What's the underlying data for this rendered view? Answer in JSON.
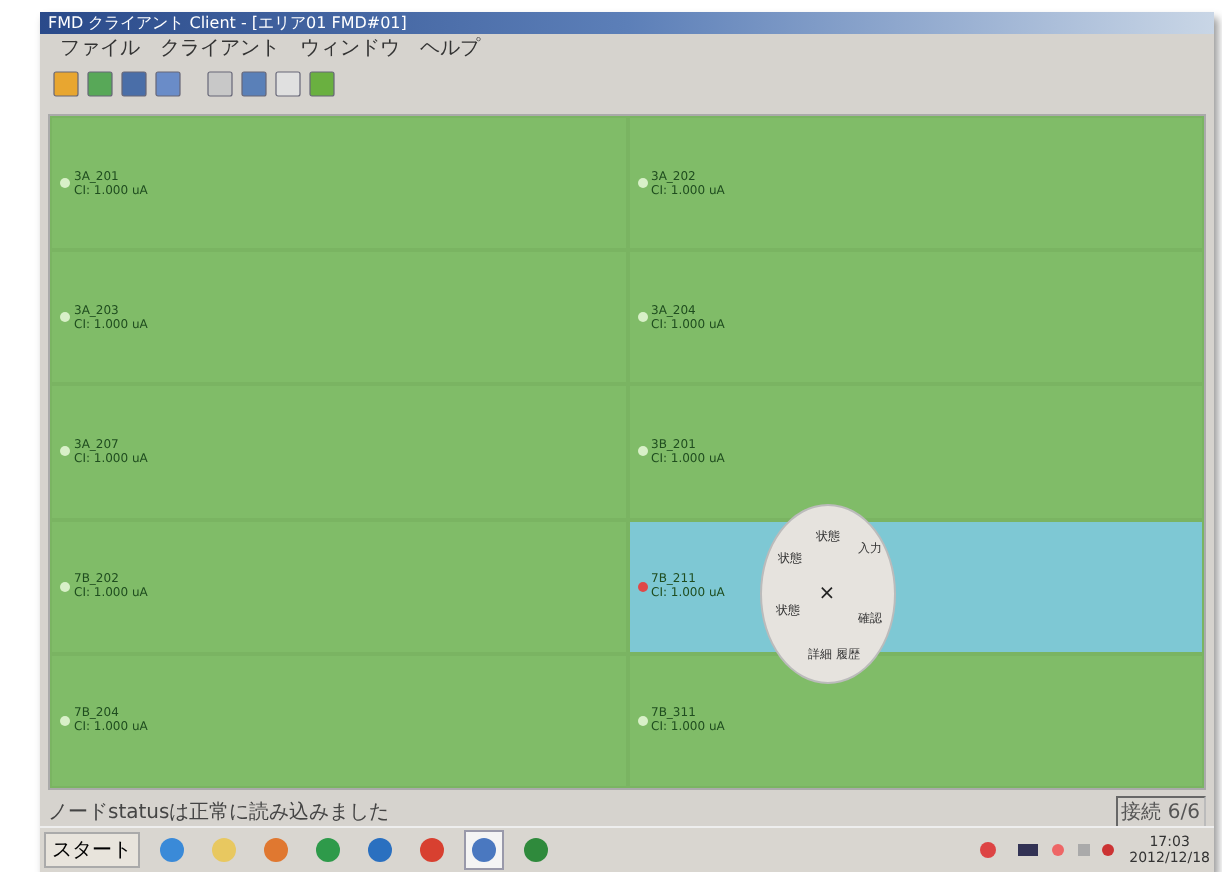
{
  "window": {
    "title": "FMD クライアント Client - [エリア01 FMD#01]"
  },
  "menu": [
    {
      "label": "ファイル"
    },
    {
      "label": "クライアント"
    },
    {
      "label": "ウィンドウ"
    },
    {
      "label": "ヘルプ"
    }
  ],
  "toolbar": [
    {
      "kind": "new"
    },
    {
      "kind": "open"
    },
    {
      "kind": "save"
    },
    {
      "kind": "grid"
    },
    {
      "kind": "sep"
    },
    {
      "kind": "page"
    },
    {
      "kind": "doc"
    },
    {
      "kind": "shield"
    },
    {
      "kind": "battery"
    }
  ],
  "tiles": [
    {
      "name": "3A_201",
      "reading": "CI:  1.000 uA",
      "color": "#d8f0c8",
      "selected": false
    },
    {
      "name": "3A_202",
      "reading": "CI:  1.000 uA",
      "color": "#d8f0c8",
      "selected": false
    },
    {
      "name": "3A_203",
      "reading": "CI:  1.000 uA",
      "color": "#d8f0c8",
      "selected": false
    },
    {
      "name": "3A_204",
      "reading": "CI:  1.000 uA",
      "color": "#d8f0c8",
      "selected": false
    },
    {
      "name": "3A_207",
      "reading": "CI:  1.000 uA",
      "color": "#d8f0c8",
      "selected": false
    },
    {
      "name": "3B_201",
      "reading": "CI:  1.000 uA",
      "color": "#d8f0c8",
      "selected": false
    },
    {
      "name": "7B_202",
      "reading": "CI:  1.000 uA",
      "color": "#d8f0c8",
      "selected": false
    },
    {
      "name": "7B_211",
      "reading": "CI:  1.000 uA",
      "color": "#e04848",
      "selected": true
    },
    {
      "name": "7B_204",
      "reading": "CI:  1.000 uA",
      "color": "#d8f0c8",
      "selected": false
    },
    {
      "name": "7B_311",
      "reading": "CI:  1.000 uA",
      "color": "#d8f0c8",
      "selected": false
    }
  ],
  "pie_menu": {
    "close": "×",
    "items": [
      "状態",
      "入力",
      "確認",
      "詳細 履歴",
      "状態",
      "状態"
    ]
  },
  "status_bar": {
    "message": "ノードstatusは正常に読み込みました",
    "info": "接続 6/6"
  },
  "taskbar": {
    "start": "スタート",
    "apps": [
      {
        "kind": "ie"
      },
      {
        "kind": "folder"
      },
      {
        "kind": "media"
      },
      {
        "kind": "green"
      },
      {
        "kind": "globe"
      },
      {
        "kind": "chrome"
      },
      {
        "kind": "network",
        "selected": true
      },
      {
        "kind": "excel",
        "selected": false
      }
    ],
    "clock": {
      "time": "17:03",
      "date": "2012/12/18"
    }
  }
}
